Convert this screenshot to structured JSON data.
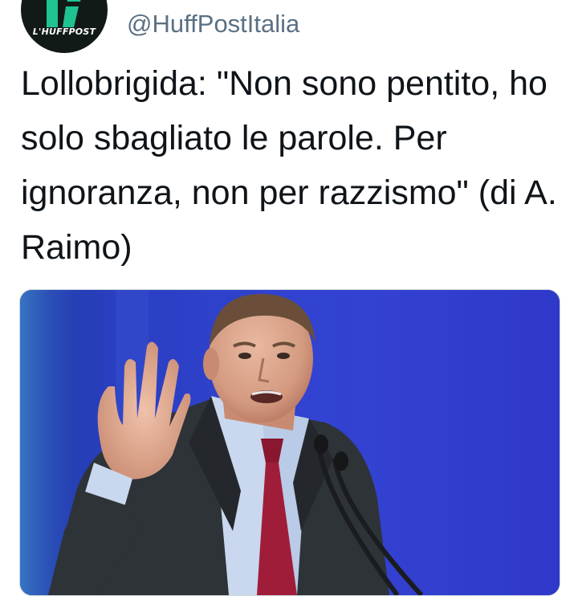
{
  "author": {
    "avatar_icon": "huffpost-logo-icon",
    "avatar_wordmark": "L'HUFFPOST",
    "handle": "@HuffPostItalia"
  },
  "tweet": {
    "text": "Lollobrigida: \"Non sono pentito, ho solo sbagliato le parole. Per ignoranza, non per razzismo\" (di A. Raimo)"
  },
  "media": {
    "kind": "photo",
    "subject": "man in dark suit and red tie speaking at microphone, gesturing with raised hand",
    "background_color": "#2837c6"
  },
  "colors": {
    "handle": "#5b7083",
    "text": "#0f1419",
    "avatar_bg": "#111a16",
    "logo_green": "#1fc291"
  }
}
